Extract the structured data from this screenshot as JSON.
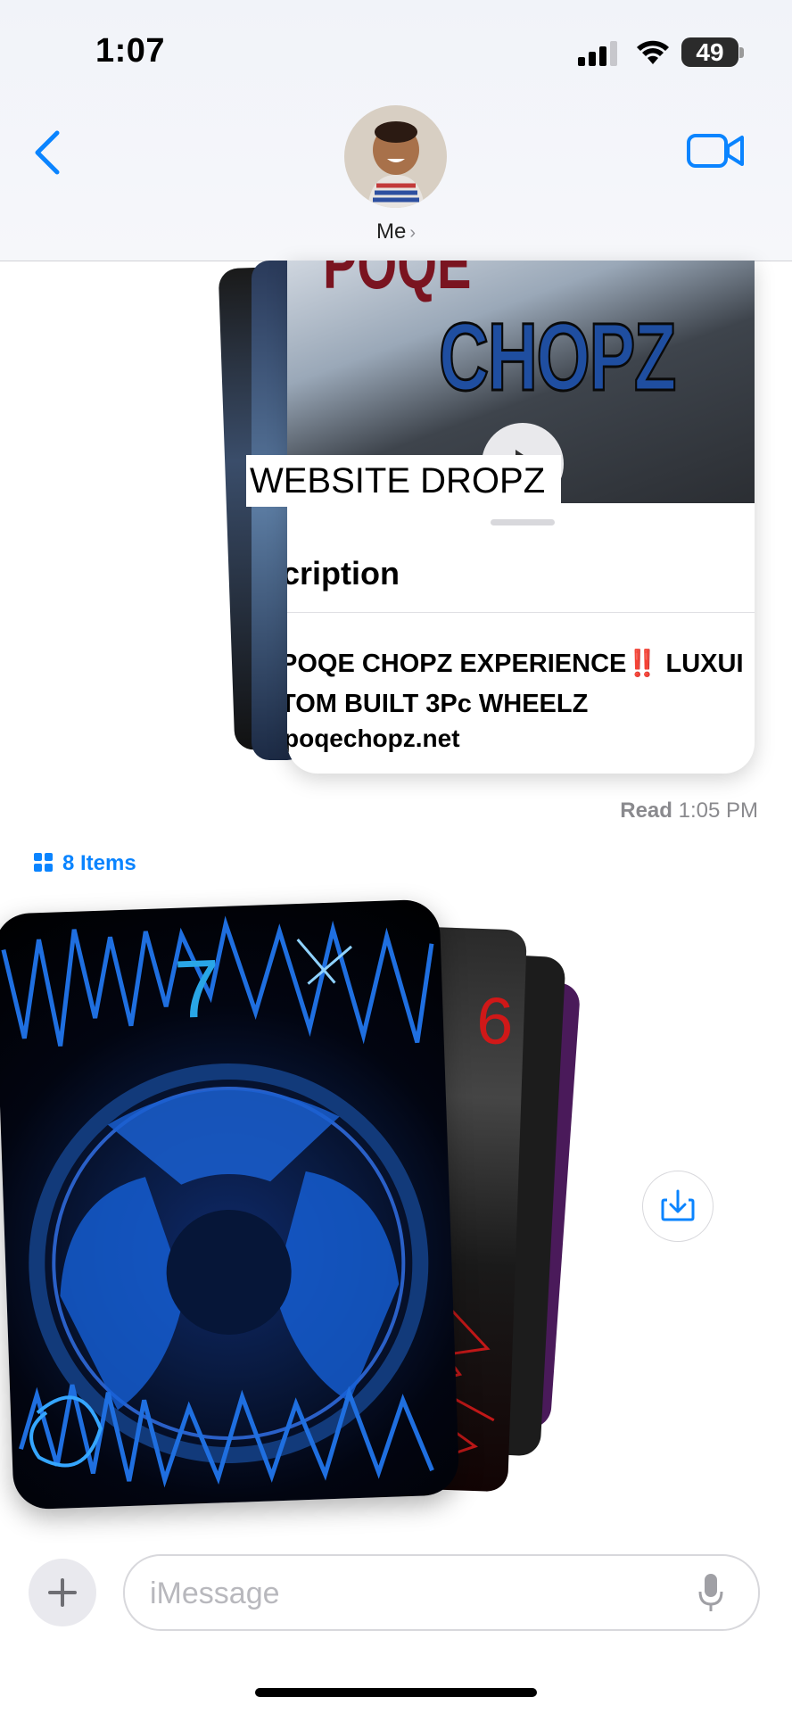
{
  "status_bar": {
    "time": "1:07",
    "battery": "49"
  },
  "header": {
    "contact_name": "Me",
    "contact_chevron": "›"
  },
  "link_card": {
    "label": "WEBSITE DROPZ",
    "thumbnail_title": "CHOPZ",
    "thumbnail_top": "POQE",
    "description_heading": "cription",
    "description_line1": "POQE CHOPZ EXPERIENCE‼️ LUXUI",
    "description_line2": "TOM BUILT 3Pc WHEELZ",
    "url": "poqechopz.net"
  },
  "read_receipt": {
    "status": "Read",
    "time": "1:05 PM"
  },
  "photo_stack": {
    "items_label": "8 Items",
    "front_number": "7",
    "back_number": "6"
  },
  "compose": {
    "placeholder": "iMessage"
  },
  "colors": {
    "accent": "#0a84ff",
    "background": "#ffffff"
  }
}
